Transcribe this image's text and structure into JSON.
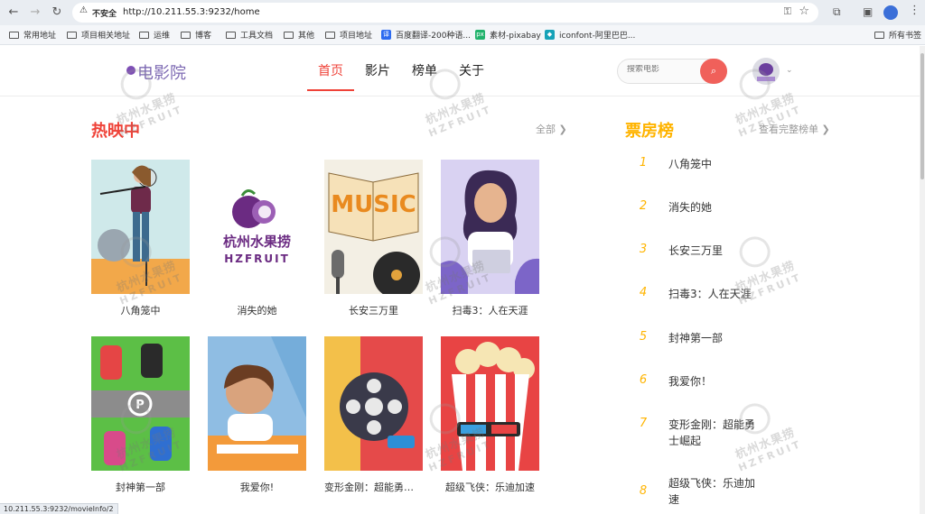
{
  "browser": {
    "security_label": "不安全",
    "url": "http://10.211.55.3:9232/home",
    "bookmarks": [
      {
        "label": "常用地址",
        "type": "folder"
      },
      {
        "label": "项目相关地址",
        "type": "folder"
      },
      {
        "label": "运维",
        "type": "folder"
      },
      {
        "label": "博客",
        "type": "folder"
      },
      {
        "label": "工具文档",
        "type": "folder"
      },
      {
        "label": "其他",
        "type": "folder"
      },
      {
        "label": "项目地址",
        "type": "folder"
      },
      {
        "label": "百度翻译-200种语...",
        "type": "site",
        "fav_text": "译",
        "color": "#2d6bf0"
      },
      {
        "label": "素材-pixabay",
        "type": "site",
        "fav_text": "px",
        "color": "#20b26b"
      },
      {
        "label": "iconfont-阿里巴巴...",
        "type": "site",
        "fav_text": "◆",
        "color": "#17a2b8"
      }
    ],
    "all_bookmarks": "所有书签",
    "status_url": "10.211.55.3:9232/movieInfo/2"
  },
  "header": {
    "logo": "电影院",
    "nav": [
      {
        "label": "首页",
        "active": true
      },
      {
        "label": "影片",
        "active": false
      },
      {
        "label": "榜单",
        "active": false
      },
      {
        "label": "关于",
        "active": false
      }
    ],
    "search_placeholder": "搜索电影",
    "search_icon": "search-icon"
  },
  "hot": {
    "title": "热映中",
    "more": "全部 ❯",
    "movies": [
      {
        "title": "八角笼中",
        "poster": "flute-player"
      },
      {
        "title": "消失的她",
        "poster": "mangosteen-logo"
      },
      {
        "title": "长安三万里",
        "poster": "music-book"
      },
      {
        "title": "扫毒3：人在天涯",
        "poster": "girl-laptop"
      },
      {
        "title": "封神第一部",
        "poster": "parking-lot"
      },
      {
        "title": "我爱你!",
        "poster": "boy-writing"
      },
      {
        "title": "变形金刚：超能勇士...",
        "poster": "film-reel"
      },
      {
        "title": "超级飞侠：乐迪加速",
        "poster": "popcorn"
      }
    ]
  },
  "boxoffice": {
    "title": "票房榜",
    "more": "查看完整榜单 ❯",
    "items": [
      {
        "rank": "1",
        "name": "八角笼中"
      },
      {
        "rank": "2",
        "name": "消失的她"
      },
      {
        "rank": "3",
        "name": "长安三万里"
      },
      {
        "rank": "4",
        "name": "扫毒3：人在天涯"
      },
      {
        "rank": "5",
        "name": "封神第一部"
      },
      {
        "rank": "6",
        "name": "我爱你！"
      },
      {
        "rank": "7",
        "name": "变形金刚：超能勇士崛起"
      },
      {
        "rank": "8",
        "name": "超级飞侠：乐迪加速"
      }
    ]
  },
  "watermark": {
    "line1": "杭州水果捞",
    "line2": "HZFRUIT"
  },
  "colors": {
    "accent": "#ef4238",
    "rank": "#ffb400",
    "logo": "#7e6ab3"
  }
}
